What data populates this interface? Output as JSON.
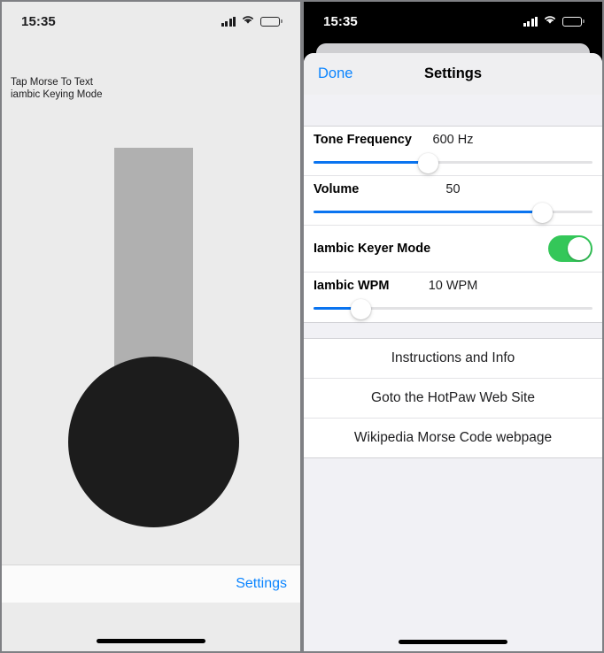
{
  "left_phone": {
    "status_bar": {
      "time": "15:35",
      "cellular_icon": "cellular-bars-icon",
      "wifi_icon": "wifi-icon",
      "battery_icon": "battery-icon"
    },
    "hint_line1": "Tap Morse To Text",
    "hint_line2": "iambic Keying Mode",
    "paddle_shape": "morse-paddle-bar",
    "key_shape": "morse-key-circle",
    "toolbar": {
      "settings_label": "Settings"
    }
  },
  "right_phone": {
    "status_bar": {
      "time": "15:35",
      "cellular_icon": "cellular-bars-icon",
      "wifi_icon": "wifi-icon",
      "battery_icon": "battery-icon"
    },
    "nav": {
      "done_label": "Done",
      "title": "Settings"
    },
    "settings": [
      {
        "type": "slider",
        "label": "Tone Frequency",
        "value": "600 Hz",
        "percent": 41
      },
      {
        "type": "slider",
        "label": "Volume",
        "value": "50",
        "percent": 82
      },
      {
        "type": "toggle",
        "label": "Iambic Keyer Mode",
        "value": "on"
      },
      {
        "type": "slider",
        "label": "Iambic WPM",
        "value": "10 WPM",
        "percent": 17
      }
    ],
    "links": [
      {
        "label": "Instructions and Info"
      },
      {
        "label": "Goto the HotPaw Web Site"
      },
      {
        "label": "Wikipedia Morse Code webpage"
      }
    ]
  },
  "colors": {
    "accent_blue": "#0a84ff",
    "slider_blue": "#0a74f0",
    "toggle_green": "#34c759",
    "key_black": "#1c1c1c",
    "paddle_gray": "#b0b0b0"
  }
}
